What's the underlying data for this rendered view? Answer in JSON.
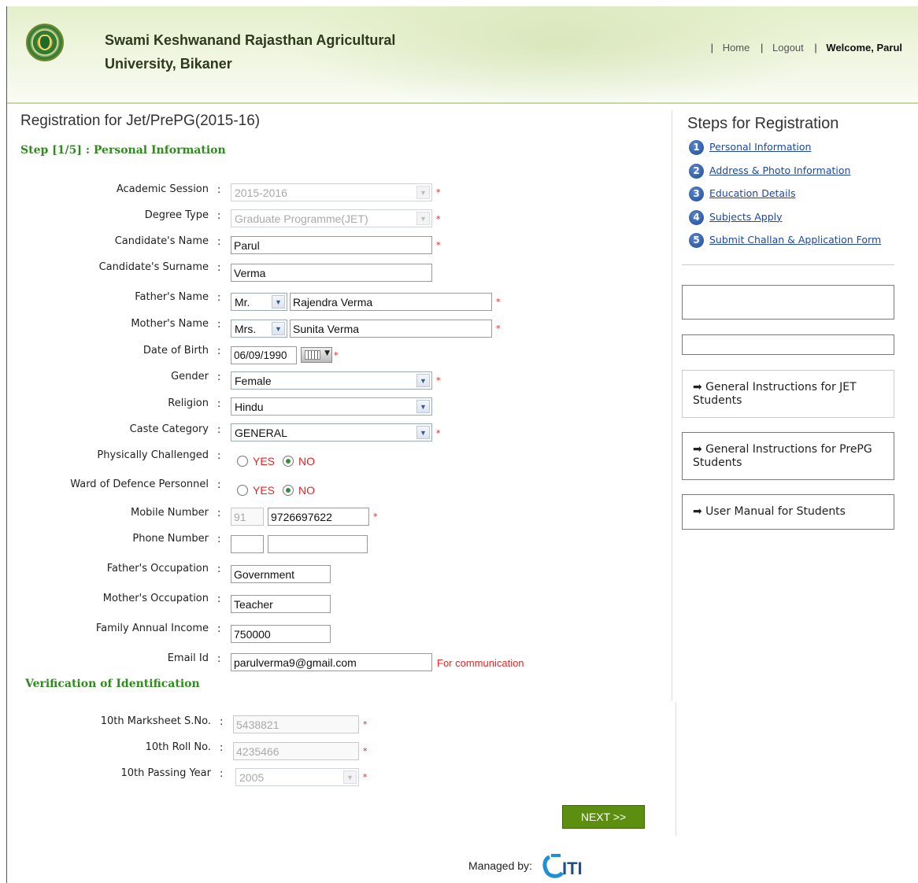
{
  "header": {
    "university_name_line1": "Swami Keshwanand Rajasthan Agricultural",
    "university_name_line2": "University, Bikaner",
    "links": {
      "home": "Home",
      "logout": "Logout",
      "welcome": "Welcome, Parul"
    },
    "separator": "|"
  },
  "page": {
    "title": "Registration for Jet/PrePG(2015-16)",
    "step_title": "Step [1/5] : Personal Information",
    "verification_title": "Verification of Identification"
  },
  "form": {
    "colon": ":",
    "required_mark": "*",
    "academic_session": {
      "label": "Academic Session",
      "value": "2015-2016"
    },
    "degree_type": {
      "label": "Degree Type",
      "value": "Graduate Programme(JET)"
    },
    "candidate_name": {
      "label": "Candidate's Name",
      "value": "Parul"
    },
    "candidate_surname": {
      "label": "Candidate's Surname",
      "value": "Verma"
    },
    "father_name": {
      "label": "Father's Name",
      "title": "Mr.",
      "value": "Rajendra Verma"
    },
    "mother_name": {
      "label": "Mother's Name",
      "title": "Mrs.",
      "value": "Sunita Verma"
    },
    "dob": {
      "label": "Date of Birth",
      "value": "06/09/1990"
    },
    "gender": {
      "label": "Gender",
      "value": "Female"
    },
    "religion": {
      "label": "Religion",
      "value": "Hindu"
    },
    "caste": {
      "label": "Caste Category",
      "value": "GENERAL"
    },
    "physically_challenged": {
      "label": "Physically Challenged",
      "yes": "YES",
      "no": "NO",
      "selected": "NO"
    },
    "ward_defence": {
      "label": "Ward of Defence Personnel",
      "yes": "YES",
      "no": "NO",
      "selected": "NO"
    },
    "mobile": {
      "label": "Mobile Number",
      "code": "91",
      "value": "9726697622"
    },
    "phone": {
      "label": "Phone Number",
      "code": "",
      "value": ""
    },
    "father_occupation": {
      "label": "Father's Occupation",
      "value": "Government"
    },
    "mother_occupation": {
      "label": "Mother's Occupation",
      "value": "Teacher"
    },
    "family_income": {
      "label": "Family Annual Income",
      "value": "750000"
    },
    "email": {
      "label": "Email Id",
      "value": "parulverma9@gmail.com",
      "note": "For communication"
    },
    "marksheet_sno": {
      "label": "10th Marksheet S.No.",
      "value": "5438821"
    },
    "roll_no": {
      "label": "10th Roll No.",
      "value": "4235466"
    },
    "passing_year": {
      "label": "10th Passing Year",
      "value": "2005"
    },
    "next_button": "NEXT >>"
  },
  "sidebar": {
    "title": "Steps for Registration",
    "steps": [
      {
        "num": "1",
        "label": "Personal Information"
      },
      {
        "num": "2",
        "label": "Address & Photo Information"
      },
      {
        "num": "3",
        "label": "Education Details"
      },
      {
        "num": "4",
        "label": "Subjects Apply"
      },
      {
        "num": "5",
        "label": "Submit Challan & Application Form"
      }
    ],
    "links": [
      "➡ General Instructions for JET Students",
      "➡ General Instructions for PrePG Students",
      "➡ User Manual for Students"
    ]
  },
  "footer": {
    "managed_by": "Managed by:",
    "logo_text": "ITI"
  }
}
